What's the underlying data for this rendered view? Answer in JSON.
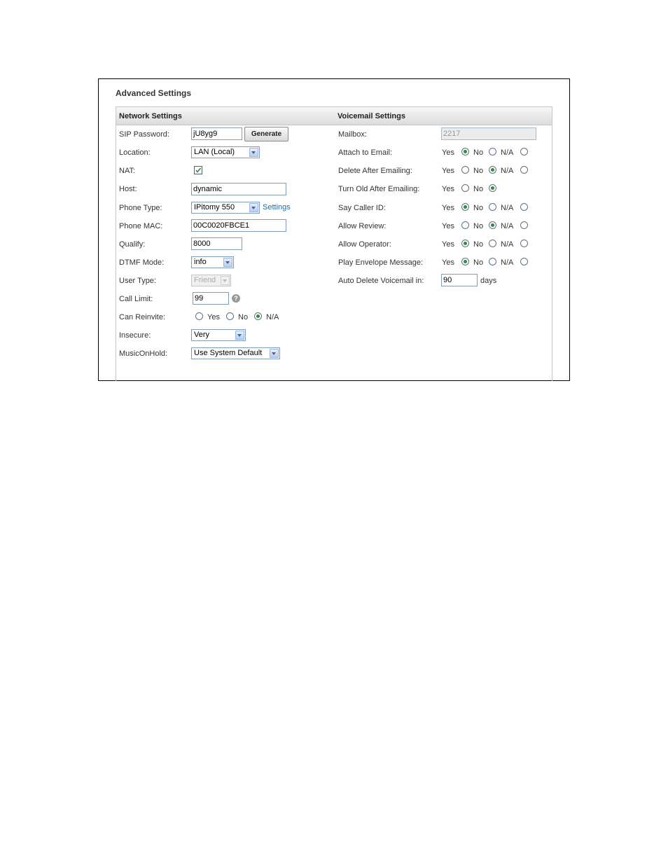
{
  "title": "Advanced Settings",
  "network": {
    "header": "Network Settings",
    "sip_password": {
      "label": "SIP Password:",
      "value": "jU8yg9",
      "button": "Generate"
    },
    "location": {
      "label": "Location:",
      "value": "LAN (Local)"
    },
    "nat": {
      "label": "NAT:",
      "checked": true
    },
    "host": {
      "label": "Host:",
      "value": "dynamic"
    },
    "phone_type": {
      "label": "Phone Type:",
      "value": "IPitomy 550",
      "link": "Settings"
    },
    "phone_mac": {
      "label": "Phone MAC:",
      "value": "00C0020FBCE1"
    },
    "qualify": {
      "label": "Qualify:",
      "value": "8000"
    },
    "dtmf_mode": {
      "label": "DTMF Mode:",
      "value": "info"
    },
    "user_type": {
      "label": "User Type:",
      "value": "Friend"
    },
    "call_limit": {
      "label": "Call Limit:",
      "value": "99"
    },
    "can_reinvite": {
      "label": "Can Reinvite:",
      "options": [
        "Yes",
        "No",
        "N/A"
      ],
      "selected": "N/A"
    },
    "insecure": {
      "label": "Insecure:",
      "value": "Very"
    },
    "music_on_hold": {
      "label": "MusicOnHold:",
      "value": "Use System Default"
    }
  },
  "voicemail": {
    "header": "Voicemail Settings",
    "mailbox": {
      "label": "Mailbox:",
      "value": "2217"
    },
    "option_labels": {
      "yes": "Yes",
      "no": "No",
      "na": "N/A"
    },
    "attach_to_email": {
      "label": "Attach to Email:",
      "selected": "yes"
    },
    "delete_after_emailing": {
      "label": "Delete After Emailing:",
      "selected": "na"
    },
    "turn_old_after_emailing": {
      "label": "Turn Old After Emailing:",
      "selected": "no"
    },
    "say_caller_id": {
      "label": "Say Caller ID:",
      "selected": "yes"
    },
    "allow_review": {
      "label": "Allow Review:",
      "selected": "na"
    },
    "allow_operator": {
      "label": "Allow Operator:",
      "selected": "yes"
    },
    "play_envelope_message": {
      "label": "Play Envelope Message:",
      "selected": "yes"
    },
    "auto_delete": {
      "label": "Auto Delete Voicemail in:",
      "value": "90",
      "unit": "days"
    }
  }
}
